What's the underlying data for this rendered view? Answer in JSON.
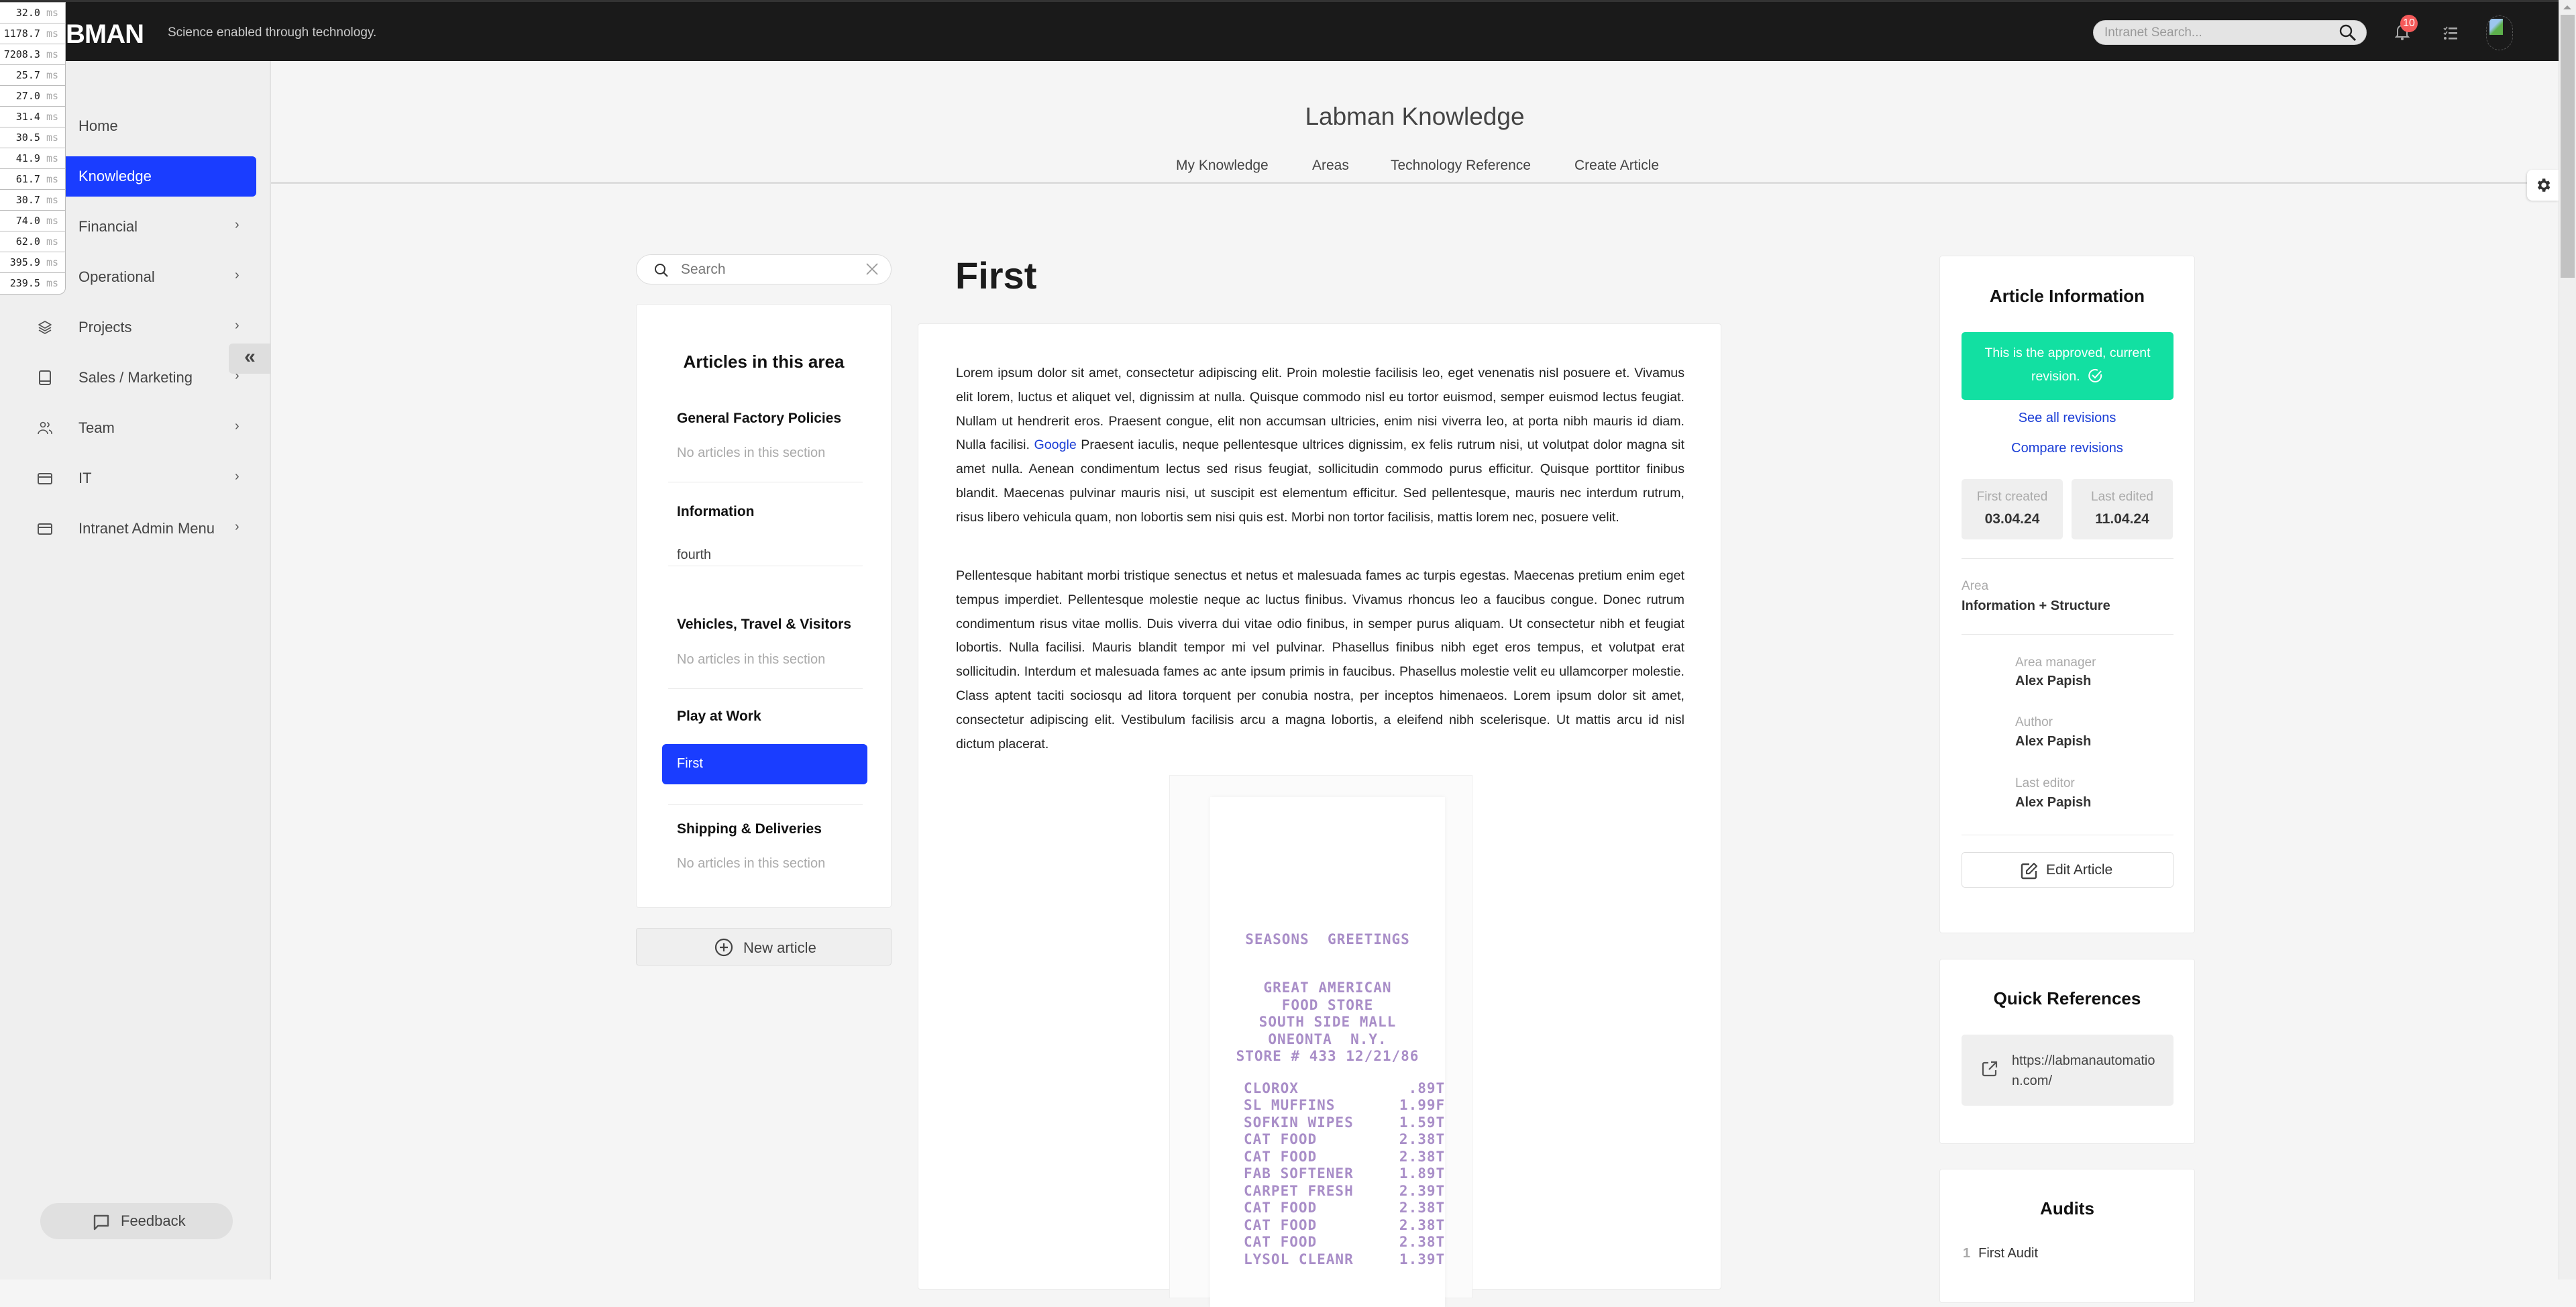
{
  "app": {
    "logo_text": "BMAN",
    "tagline": "Science enabled through technology.",
    "search_placeholder": "Intranet Search...",
    "notification_count": "10",
    "colors": {
      "accent": "#1a3dff",
      "approved": "#12e0a2",
      "link": "#1a3dd6",
      "badge": "#f55a5a",
      "topbar": "#1a1a1a"
    }
  },
  "perf_overlay": {
    "unit": "ms",
    "values": [
      "32.0",
      "1178.7",
      "7208.3",
      "25.7",
      "27.0",
      "31.4",
      "30.5",
      "41.9",
      "61.7",
      "30.7",
      "74.0",
      "62.0",
      "395.9",
      "239.5"
    ]
  },
  "sidebar": {
    "items": [
      {
        "label": "Home",
        "icon": "home-icon",
        "has_children": false,
        "active": false
      },
      {
        "label": "Knowledge",
        "icon": "book-icon",
        "has_children": false,
        "active": true
      },
      {
        "label": "Financial",
        "icon": "finance-icon",
        "has_children": true,
        "active": false
      },
      {
        "label": "Operational",
        "icon": "operations-icon",
        "has_children": true,
        "active": false
      },
      {
        "label": "Projects",
        "icon": "layers-icon",
        "has_children": true,
        "active": false
      },
      {
        "label": "Sales / Marketing",
        "icon": "book-icon",
        "has_children": true,
        "active": false
      },
      {
        "label": "Team",
        "icon": "users-icon",
        "has_children": true,
        "active": false
      },
      {
        "label": "IT",
        "icon": "card-icon",
        "has_children": true,
        "active": false
      },
      {
        "label": "Intranet Admin Menu",
        "icon": "card-icon",
        "has_children": true,
        "active": false
      }
    ],
    "collapse_glyph": "«",
    "feedback_label": "Feedback"
  },
  "knowledge_header": {
    "title": "Labman Knowledge",
    "nav": [
      "My Knowledge",
      "Areas",
      "Technology Reference",
      "Create Article"
    ]
  },
  "articles_panel": {
    "search_placeholder": "Search",
    "title": "Articles in this area",
    "sections": [
      {
        "title": "General Factory Policies",
        "empty_text": "No articles in this section",
        "articles": []
      },
      {
        "title": "Information",
        "articles": [
          "fourth"
        ]
      },
      {
        "title": "Vehicles, Travel & Visitors",
        "empty_text": "No articles in this section",
        "articles": []
      },
      {
        "title": "Play at Work",
        "articles": [
          "First"
        ],
        "active_article": "First"
      },
      {
        "title": "Shipping & Deliveries",
        "empty_text": "No articles in this section",
        "articles": []
      }
    ],
    "new_article_label": "New article"
  },
  "article": {
    "title": "First",
    "paragraph1_before_link": "Lorem ipsum dolor sit amet, consectetur adipiscing elit. Proin molestie facilisis leo, eget venenatis nisl posuere et. Vivamus elit lorem, luctus et aliquet vel, dignissim at nulla. Quisque commodo nisl eu tortor euismod, semper euismod lectus feugiat. Nullam ut hendrerit eros. Praesent congue, elit non accumsan ultricies, enim nisi viverra leo, at porta nibh mauris id diam. Nulla facilisi. ",
    "paragraph1_link": "Google",
    "paragraph1_after_link": " Praesent iaculis, neque pellentesque ultrices dignissim, ex felis rutrum nisi, ut volutpat dolor magna sit amet nulla. Aenean condimentum lectus sed risus feugiat, sollicitudin commodo purus efficitur. Quisque porttitor finibus blandit. Maecenas pulvinar mauris nisi, ut suscipit est elementum efficitur. Sed pellentesque, mauris nec interdum rutrum, risus libero vehicula quam, non lobortis sem nisi quis est. Morbi non tortor facilisis, mattis lorem nec, posuere velit.",
    "paragraph2": "Pellentesque habitant morbi tristique senectus et netus et malesuada fames ac turpis egestas. Maecenas pretium enim eget tempus imperdiet. Pellentesque molestie neque ac luctus finibus. Vivamus rhoncus leo a faucibus congue. Donec rutrum condimentum risus vitae mollis. Duis viverra dui vitae odio finibus, in semper purus aliquam. Ut consectetur nibh et feugiat lobortis. Nulla facilisi. Mauris blandit tempor mi vel pulvinar. Phasellus finibus nibh eget eros tempus, et volutpat erat sollicitudin. Interdum et malesuada fames ac ante ipsum primis in faucibus. Phasellus molestie velit eu ullamcorper molestie. Class aptent taciti sociosqu ad litora torquent per conubia nostra, per inceptos himenaeos. Lorem ipsum dolor sit amet, consectetur adipiscing elit. Vestibulum facilisis arcu a magna lobortis, a eleifend nibh scelerisque. Ut mattis arcu id nisl dictum placerat.",
    "receipt_lines": [
      "SEASONS  GREETINGS",
      "",
      "GREAT AMERICAN",
      "FOOD STORE",
      "SOUTH SIDE MALL",
      "ONEONTA  N.Y.",
      "STORE # 433 12/21/86",
      "",
      "CLOROX            .89T",
      "SL MUFFINS       1.99F",
      "SOFKIN WIPES     1.59T",
      "CAT FOOD         2.38T",
      "CAT FOOD         2.38T",
      "FAB SOFTENER     1.89T",
      "CARPET FRESH     2.39T",
      "CAT FOOD         2.38T",
      "CAT FOOD         2.38T",
      "CAT FOOD         2.38T",
      "LYSOL CLEANR     1.39T"
    ]
  },
  "article_info": {
    "title": "Article Information",
    "approved_text": "This is the approved, current revision.",
    "see_all_revisions": "See all revisions",
    "compare_revisions": "Compare revisions",
    "first_created_label": "First created",
    "first_created": "03.04.24",
    "last_edited_label": "Last edited",
    "last_edited": "11.04.24",
    "area_label": "Area",
    "area": "Information + Structure",
    "area_manager_label": "Area manager",
    "area_manager": "Alex Papish",
    "author_label": "Author",
    "author": "Alex Papish",
    "last_editor_label": "Last editor",
    "last_editor": "Alex Papish",
    "edit_label": "Edit Article"
  },
  "quick_references": {
    "title": "Quick References",
    "items": [
      "https://labmanautomation.com/"
    ]
  },
  "audits": {
    "title": "Audits",
    "items": [
      {
        "number": "1",
        "label": "First Audit"
      }
    ]
  }
}
